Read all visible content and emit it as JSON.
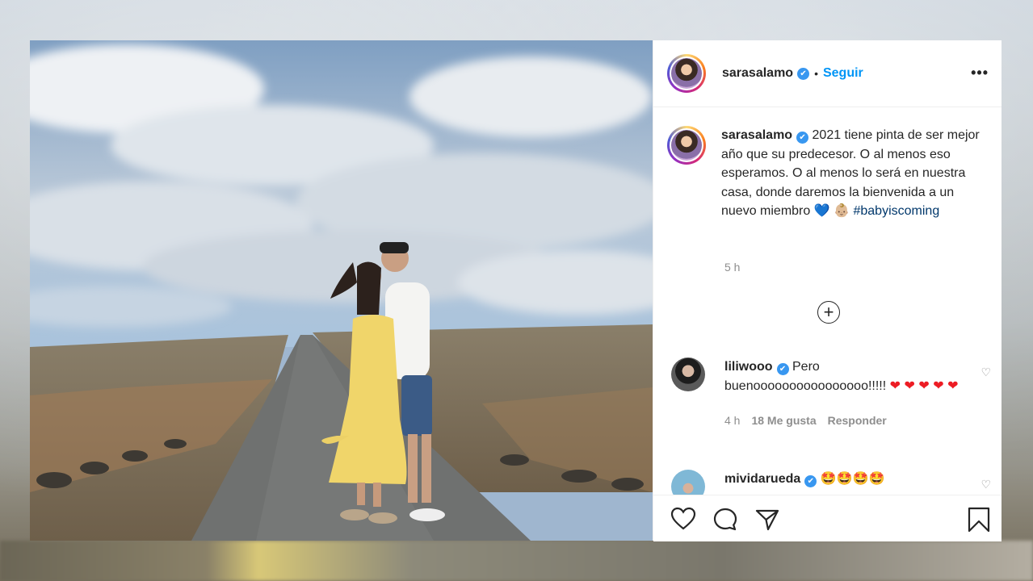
{
  "post": {
    "username": "sarasalamo",
    "follow_label": "Seguir",
    "dot": "•",
    "more": "•••",
    "caption": "2021 tiene pinta de ser mejor año que su predecesor. O al menos eso esperamos. O al menos lo será en nuestra casa, donde daremos la bienvenida a un nuevo miembro",
    "caption_blue_heart": "💙",
    "caption_baby_emoji": "👶🏼",
    "hashtag": "#babyiscoming",
    "time": "5 h",
    "load_more": "+"
  },
  "comments": [
    {
      "username": "liliwooo",
      "text": "Pero buenoooooooooooooooo!!!!!",
      "hearts": "❤ ❤ ❤ ❤ ❤",
      "time": "4 h",
      "likes": "18 Me gusta",
      "reply": "Responder",
      "like_icon": "♡"
    },
    {
      "username": "mividarueda",
      "text": "🤩🤩🤩🤩",
      "like_icon": "♡"
    }
  ],
  "icons": {
    "like": "heart-outline-icon",
    "comment": "comment-bubble-icon",
    "share": "paper-plane-icon",
    "save": "bookmark-icon",
    "verified": "✔"
  },
  "colors": {
    "link_blue": "#0095f6",
    "verified_blue": "#3897f0",
    "hashtag": "#00376b",
    "muted": "#8e8e8e"
  }
}
